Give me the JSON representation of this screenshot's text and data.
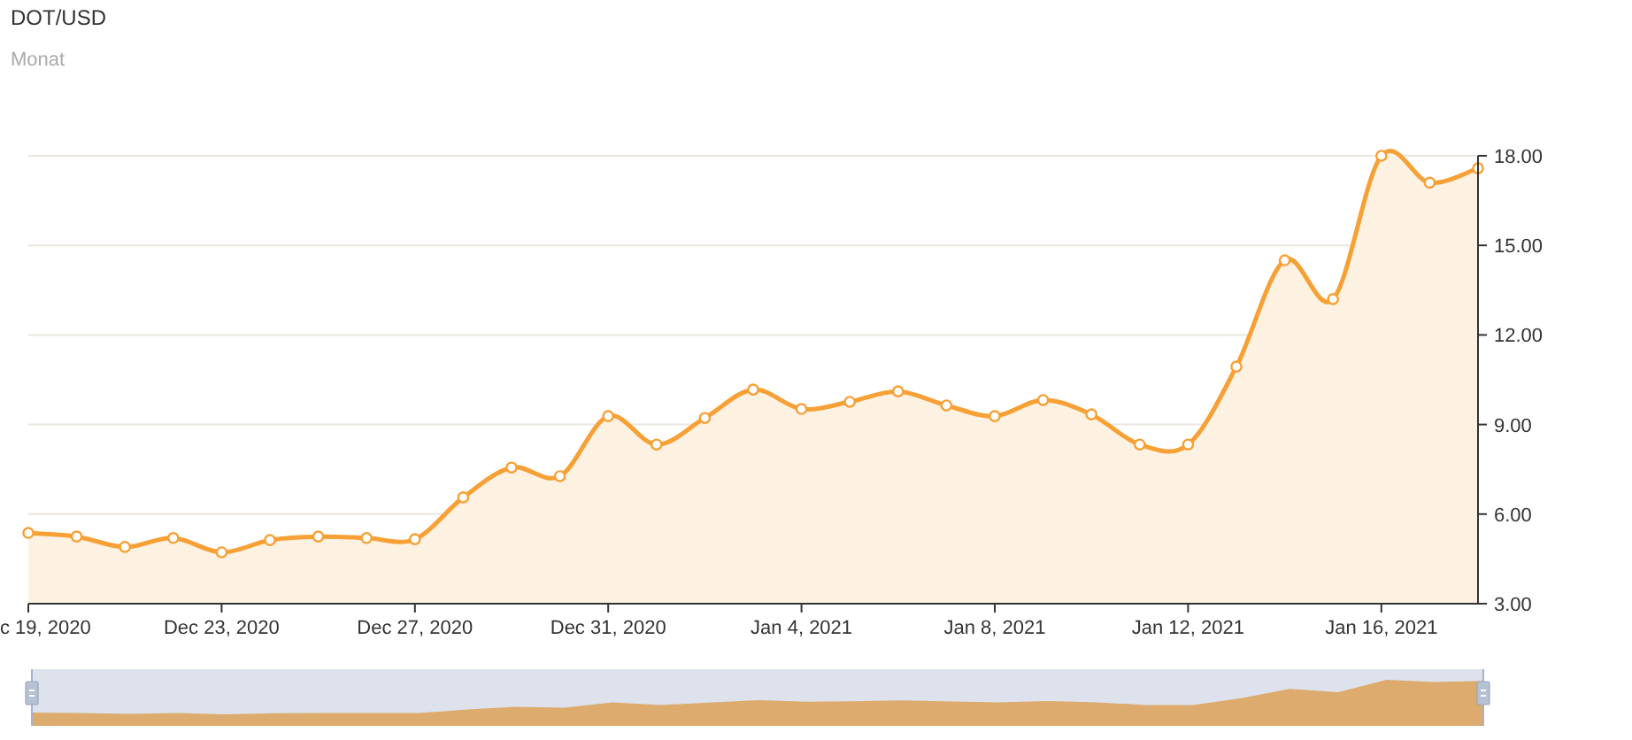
{
  "header": {
    "title": "DOT/USD",
    "subtitle": "Monat"
  },
  "chart": {
    "chart_data": {
      "type": "area",
      "categories": [
        "c 19, 2020",
        null,
        null,
        null,
        "Dec 23, 2020",
        null,
        null,
        null,
        "Dec 27, 2020",
        null,
        null,
        null,
        "Dec 31, 2020",
        null,
        null,
        null,
        "Jan 4, 2021",
        null,
        null,
        null,
        "Jan 8, 2021",
        null,
        null,
        null,
        "Jan 12, 2021",
        null,
        null,
        null,
        "Jan 16, 2021",
        null,
        null
      ],
      "values": [
        5.37,
        5.25,
        4.9,
        5.2,
        4.72,
        5.13,
        5.25,
        5.2,
        5.16,
        6.56,
        7.56,
        7.27,
        9.28,
        8.33,
        9.22,
        10.17,
        9.52,
        9.76,
        10.11,
        9.64,
        9.28,
        9.82,
        9.34,
        8.33,
        8.33,
        10.94,
        14.5,
        13.2,
        18.0,
        17.1,
        17.58
      ],
      "ylim": [
        3,
        18
      ],
      "grid": true,
      "yticks": [
        {
          "value": 3,
          "label": "3.00"
        },
        {
          "value": 6,
          "label": "6.00"
        },
        {
          "value": 9,
          "label": "9.00"
        },
        {
          "value": 12,
          "label": "12.00"
        },
        {
          "value": 15,
          "label": "15.00"
        },
        {
          "value": 18,
          "label": "18.00"
        }
      ]
    }
  }
}
